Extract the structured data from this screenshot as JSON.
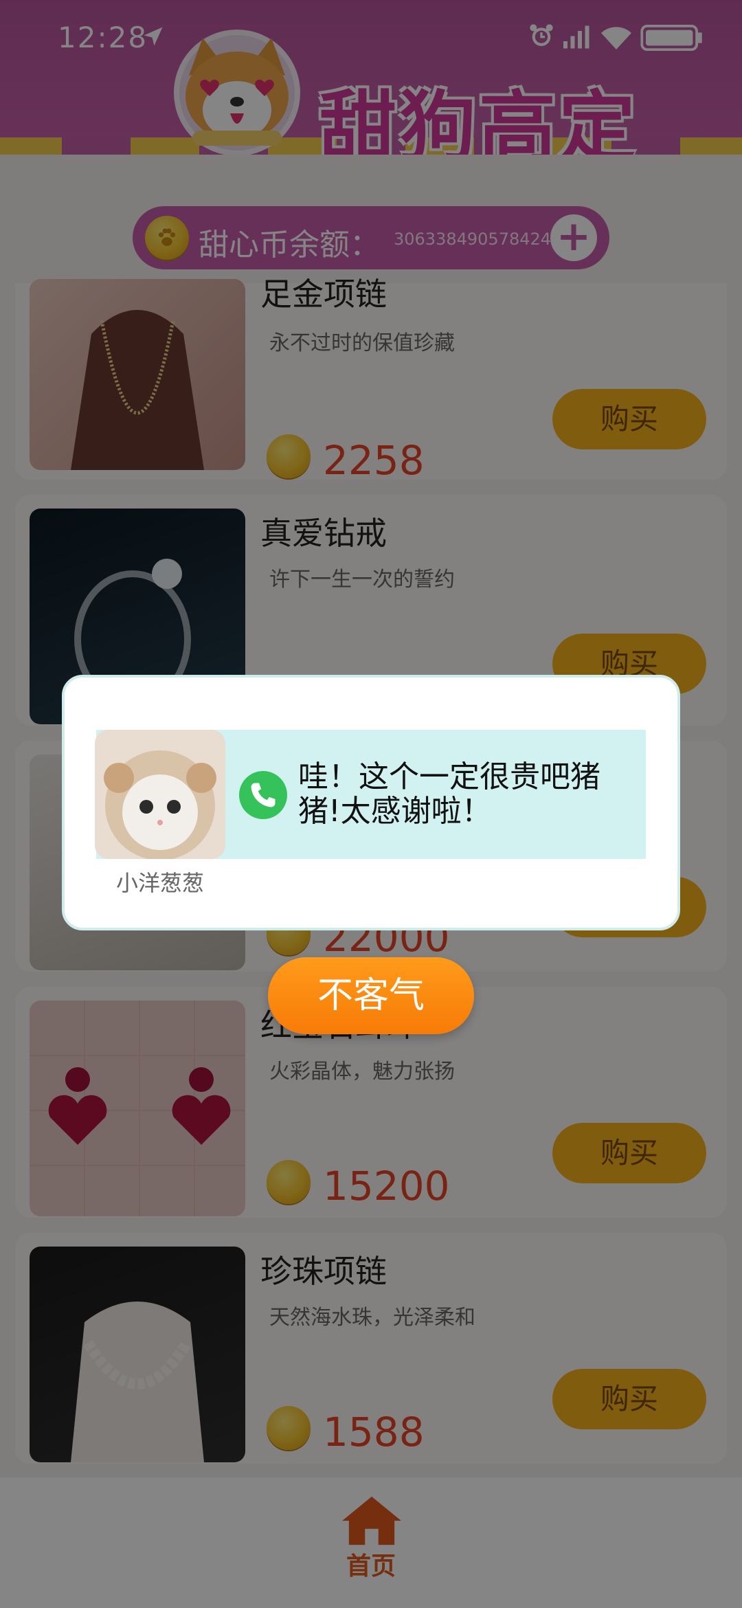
{
  "status_bar": {
    "time": "12:28"
  },
  "header": {
    "logo_text": "甜狗高定"
  },
  "balance": {
    "label": "甜心币余额：",
    "value": "306338490578424",
    "add_icon": "plus-icon"
  },
  "products": [
    {
      "name": "足金项链",
      "desc": "永不过时的保值珍藏",
      "price": "2258",
      "buy_label": "购买"
    },
    {
      "name": "真爱钻戒",
      "desc": "许下一生一次的誓约",
      "price": "",
      "buy_label": "购买"
    },
    {
      "name": "",
      "desc": "",
      "price": "22000",
      "buy_label": ""
    },
    {
      "name": "红宝石耳环",
      "desc": "火彩晶体，魅力张扬",
      "price": "15200",
      "buy_label": "购买"
    },
    {
      "name": "珍珠项链",
      "desc": "天然海水珠，光泽柔和",
      "price": "1588",
      "buy_label": "购买"
    }
  ],
  "bottom_nav": {
    "home_label": "首页",
    "home_icon": "home-icon"
  },
  "dialog": {
    "sender": "小洋葱葱",
    "message": "哇！这个一定很贵吧猪猪!太感谢啦！",
    "confirm_label": "不客气",
    "call_icon": "phone-icon"
  },
  "colors": {
    "header": "#c05ca6",
    "buy_button": "#f6b21b",
    "price": "#e8432a",
    "confirm_button": "#f98a0f",
    "message_bg": "#d2f2f1"
  }
}
